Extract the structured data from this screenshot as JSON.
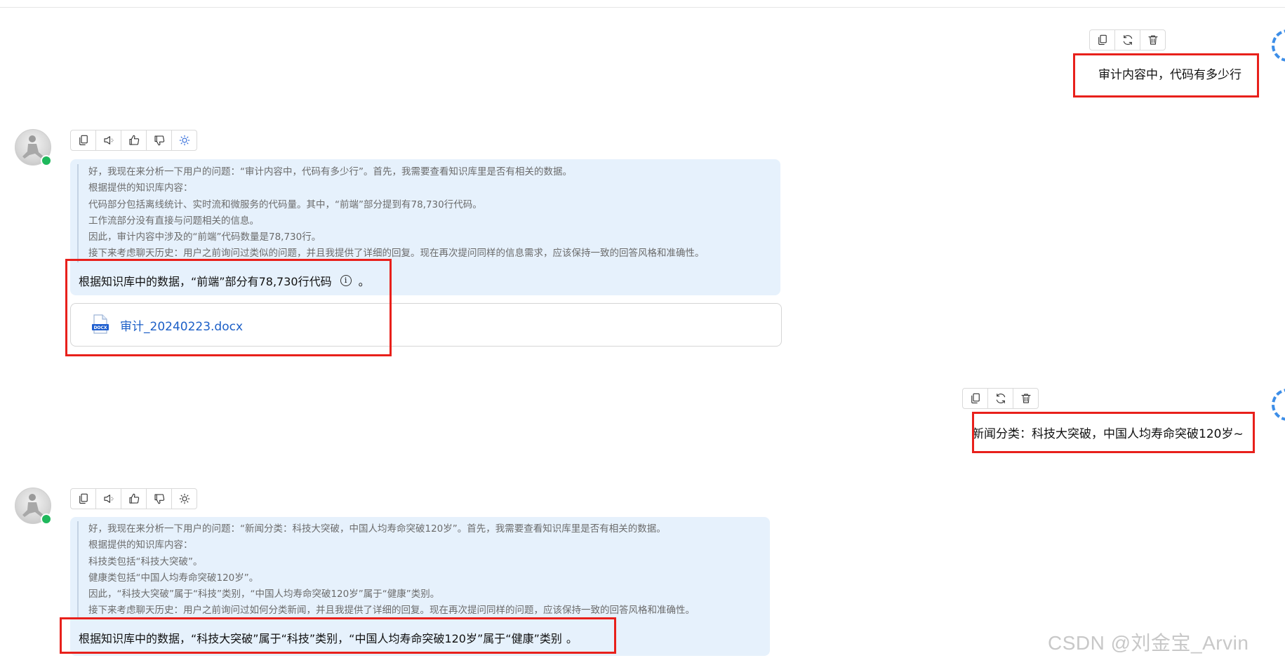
{
  "conversation": [
    {
      "role": "user",
      "text": "审计内容中，代码有多少行",
      "actions": [
        "copy-icon",
        "refresh-icon",
        "trash-icon"
      ]
    },
    {
      "role": "assistant",
      "actions": [
        "copy-icon",
        "speaker-icon",
        "thumbs-up-icon",
        "thumbs-down-icon",
        "lightbulb-icon"
      ],
      "reasoning": [
        "好，我现在来分析一下用户的问题：“审计内容中，代码有多少行”。首先，我需要查看知识库里是否有相关的数据。",
        "根据提供的知识库内容：",
        "代码部分包括离线统计、实时流和微服务的代码量。其中，“前端”部分提到有78,730行代码。",
        "工作流部分没有直接与问题相关的信息。",
        "因此，审计内容中涉及的“前端”代码数量是78,730行。",
        "接下来考虑聊天历史：用户之前询问过类似的问题，并且我提供了详细的回复。现在再次提问同样的信息需求，应该保持一致的回答风格和准确性。"
      ],
      "answer": "根据知识库中的数据，“前端”部分有78,730行代码",
      "answer_suffix": "。",
      "info_glyph": "i",
      "attachment": {
        "file_name": "审计_20240223.docx",
        "badge": "DOCX"
      }
    },
    {
      "role": "user",
      "text": "新闻分类：科技大突破，中国人均寿命突破120岁~",
      "actions": [
        "copy-icon",
        "refresh-icon",
        "trash-icon"
      ]
    },
    {
      "role": "assistant",
      "actions": [
        "copy-icon",
        "speaker-icon",
        "thumbs-up-icon",
        "thumbs-down-icon",
        "lightbulb-icon"
      ],
      "reasoning": [
        "好，我现在来分析一下用户的问题：“新闻分类：科技大突破，中国人均寿命突破120岁”。首先，我需要查看知识库里是否有相关的数据。",
        "根据提供的知识库内容：",
        "科技类包括“科技大突破”。",
        "健康类包括“中国人均寿命突破120岁”。",
        "因此，“科技大突破”属于“科技”类别，“中国人均寿命突破120岁”属于“健康”类别。",
        "接下来考虑聊天历史：用户之前询问过如何分类新闻，并且我提供了详细的回复。现在再次提问同样的问题，应该保持一致的回答风格和准确性。"
      ],
      "answer": "根据知识库中的数据，“科技大突破”属于“科技”类别，“中国人均寿命突破120岁”属于“健康”类别",
      "answer_suffix": "。"
    }
  ],
  "watermark": "CSDN @刘金宝_Arvin",
  "colors": {
    "highlight_box": "#e8201b",
    "panel_bg": "#e6f1fc",
    "link": "#1c5fc7",
    "online": "#1fb85c"
  }
}
